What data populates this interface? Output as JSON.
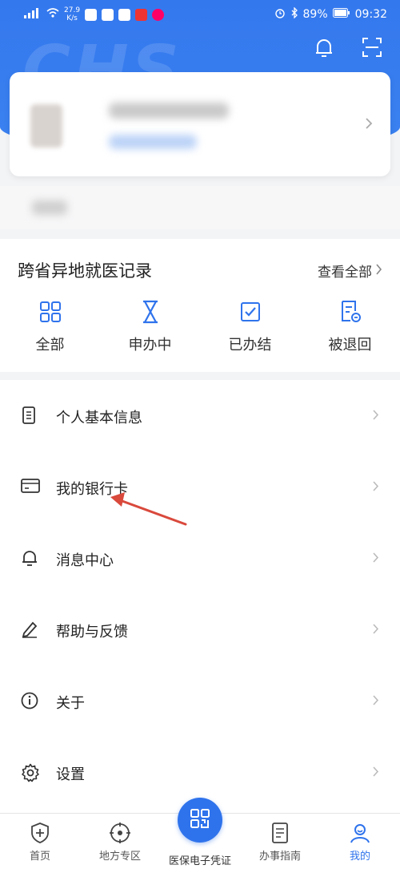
{
  "status_bar": {
    "speed_value": "27.9",
    "speed_unit": "K/s",
    "battery": "89%",
    "time": "09:32"
  },
  "header": {
    "bg_text": "CHS",
    "bell_icon": "bell-icon",
    "scan_icon": "scan-icon"
  },
  "records": {
    "title": "跨省异地就医记录",
    "view_all": "查看全部",
    "items": [
      {
        "label": "全部",
        "icon": "grid-icon"
      },
      {
        "label": "申办中",
        "icon": "hourglass-icon"
      },
      {
        "label": "已办结",
        "icon": "checkbox-icon"
      },
      {
        "label": "被退回",
        "icon": "returned-doc-icon"
      }
    ]
  },
  "menu": {
    "items": [
      {
        "label": "个人基本信息",
        "icon": "document-icon"
      },
      {
        "label": "我的银行卡",
        "icon": "bank-card-icon"
      },
      {
        "label": "消息中心",
        "icon": "bell-icon"
      },
      {
        "label": "帮助与反馈",
        "icon": "pen-icon"
      },
      {
        "label": "关于",
        "icon": "info-icon"
      },
      {
        "label": "设置",
        "icon": "gear-icon"
      }
    ]
  },
  "tabbar": {
    "tabs": [
      {
        "label": "首页",
        "icon": "shield-plus-icon"
      },
      {
        "label": "地方专区",
        "icon": "target-icon"
      },
      {
        "label": "医保电子凭证",
        "icon": "qr-code-icon"
      },
      {
        "label": "办事指南",
        "icon": "doc-list-icon"
      },
      {
        "label": "我的",
        "icon": "user-icon"
      }
    ],
    "active_index": 4
  },
  "colors": {
    "primary": "#3478ee",
    "arrow": "#d9493c"
  }
}
